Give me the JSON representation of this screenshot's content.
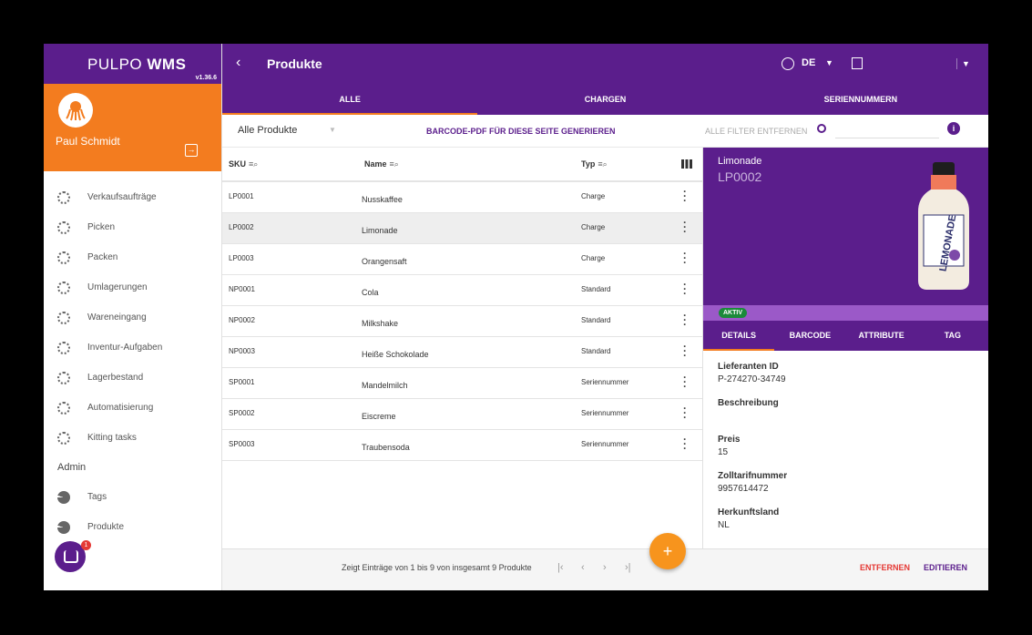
{
  "brand": {
    "logo_light": "PULPO",
    "logo_bold": "WMS",
    "version": "v1.36.6"
  },
  "user": {
    "name": "Paul Schmidt"
  },
  "nav": {
    "items": [
      {
        "label": "Verkaufsaufträge"
      },
      {
        "label": "Picken"
      },
      {
        "label": "Packen"
      },
      {
        "label": "Umlagerungen"
      },
      {
        "label": "Wareneingang"
      },
      {
        "label": "Inventur-Aufgaben"
      },
      {
        "label": "Lagerbestand"
      },
      {
        "label": "Automatisierung"
      },
      {
        "label": "Kitting tasks"
      }
    ],
    "admin_label": "Admin",
    "admin_items": [
      {
        "label": "Tags"
      },
      {
        "label": "Produkte"
      }
    ],
    "chat_badge": "1"
  },
  "header": {
    "title": "Produkte",
    "language": "DE"
  },
  "tabs": [
    {
      "label": "ALLE",
      "active": true
    },
    {
      "label": "CHARGEN"
    },
    {
      "label": "SERIENNUMMERN"
    }
  ],
  "filter": {
    "select_value": "Alle Produkte",
    "barcode_button": "BARCODE-PDF FÜR DIESE SEITE GENERIEREN",
    "clear_filters": "ALLE FILTER ENTFERNEN",
    "search_placeholder": ""
  },
  "table": {
    "columns": [
      "SKU",
      "Name",
      "Typ"
    ],
    "rows": [
      {
        "sku": "LP0001",
        "name": "Nusskaffee",
        "type": "Charge"
      },
      {
        "sku": "LP0002",
        "name": "Limonade",
        "type": "Charge"
      },
      {
        "sku": "LP0003",
        "name": "Orangensaft",
        "type": "Charge"
      },
      {
        "sku": "NP0001",
        "name": "Cola",
        "type": "Standard"
      },
      {
        "sku": "NP0002",
        "name": "Milkshake",
        "type": "Standard"
      },
      {
        "sku": "NP0003",
        "name": "Heiße Schokolade",
        "type": "Standard"
      },
      {
        "sku": "SP0001",
        "name": "Mandelmilch",
        "type": "Seriennummer"
      },
      {
        "sku": "SP0002",
        "name": "Eiscreme",
        "type": "Seriennummer"
      },
      {
        "sku": "SP0003",
        "name": "Traubensoda",
        "type": "Seriennummer"
      }
    ]
  },
  "footer": {
    "page_info": "Zeigt Einträge von 1 bis 9 von insgesamt 9 Produkte",
    "remove": "ENTFERNEN",
    "edit": "EDITIEREN"
  },
  "detail": {
    "name": "Limonade",
    "sku": "LP0002",
    "label_text": "LEMONADE",
    "status": "AKTIV",
    "tabs": [
      "DETAILS",
      "BARCODE",
      "ATTRIBUTE",
      "TAG"
    ],
    "fields": [
      {
        "label": "Lieferanten ID",
        "value": "P-274270-34749"
      },
      {
        "label": "Beschreibung",
        "value": ""
      },
      {
        "label": "Preis",
        "value": "15"
      },
      {
        "label": "Zolltarifnummer",
        "value": "9957614472"
      },
      {
        "label": "Herkunftsland",
        "value": "NL"
      }
    ]
  },
  "colors": {
    "primary": "#5b1e8c",
    "accent": "#f37c1f",
    "danger": "#e53935",
    "success": "#1b8a3a"
  }
}
